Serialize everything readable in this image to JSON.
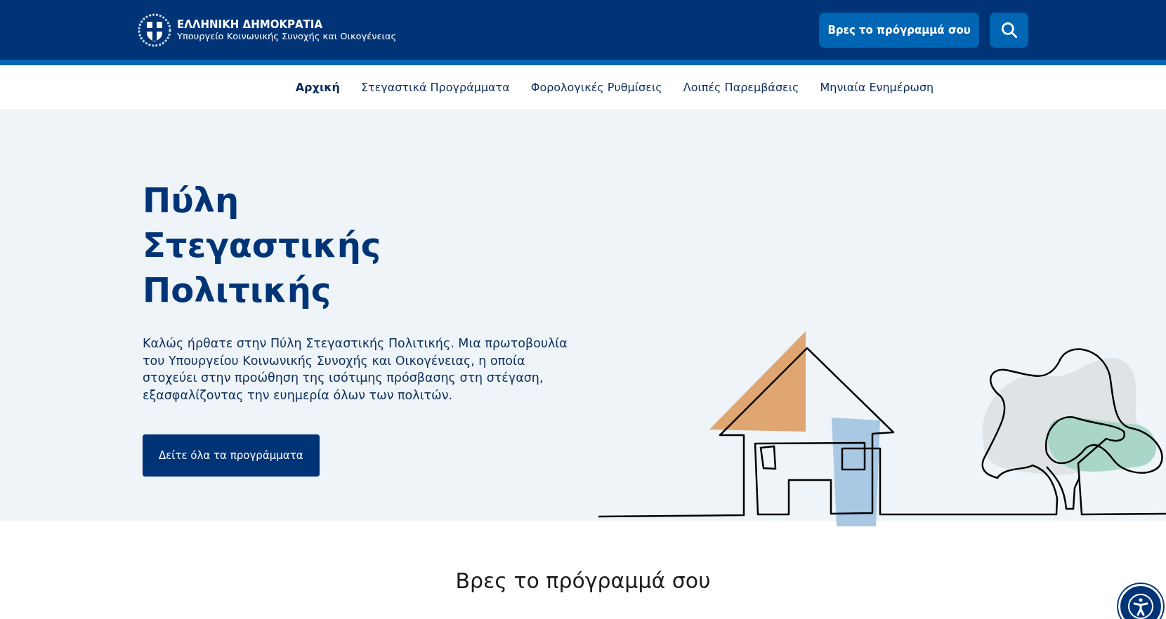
{
  "header": {
    "title": "ΕΛΛΗΝΙΚΗ ΔΗΜΟΚΡΑΤΙΑ",
    "subtitle": "Υπουργείο Κοινωνικής Συνοχής και Οικογένειας",
    "cta": "Βρες το πρόγραμμά σου"
  },
  "nav": [
    {
      "label": "Αρχική",
      "selected": true
    },
    {
      "label": "Στεγαστικά Προγράμματα",
      "selected": false
    },
    {
      "label": "Φορολογικές Ρυθμίσεις",
      "selected": false
    },
    {
      "label": "Λοιπές Παρεμβάσεις",
      "selected": false
    },
    {
      "label": "Μηνιαία Ενημέρωση",
      "selected": false
    }
  ],
  "hero": {
    "title": "Πύλη Στεγαστικής Πολιτικής",
    "text": "Καλώς ήρθατε στην Πύλη Στεγαστικής Πολιτικής. Μια πρωτοβουλία του Υπουργείου Κοινωνικής Συνοχής και Οικογένειας, η οποία στοχεύει στην προώθηση της ισότιμης πρόσβασης στη στέγαση, εξασφαλίζοντας την ευημερία όλων των πολιτών.",
    "button": "Δείτε όλα τα προγράμματα"
  },
  "section": {
    "heading": "Βρες το πρόγραμμά σου"
  }
}
